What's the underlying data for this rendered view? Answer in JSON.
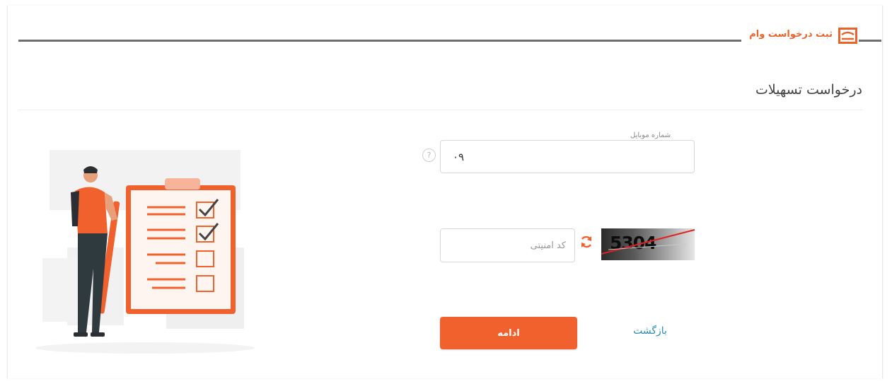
{
  "header": {
    "title": "ثبت درخواست وام",
    "icon": "loan-app-logo-icon"
  },
  "page": {
    "title": "درخواست تسهیلات"
  },
  "form": {
    "mobile": {
      "label": "شماره موبایل",
      "value": "۰۹",
      "help_icon": "help-circle-icon"
    },
    "captcha": {
      "placeholder": "کد امنیتی",
      "code": "5304",
      "refresh_icon": "refresh-icon"
    },
    "continue_label": "ادامه",
    "back_label": "بازگشت"
  },
  "colors": {
    "accent": "#f0612d",
    "link": "#2a8fb0",
    "header_line": "#6e6e6e"
  }
}
